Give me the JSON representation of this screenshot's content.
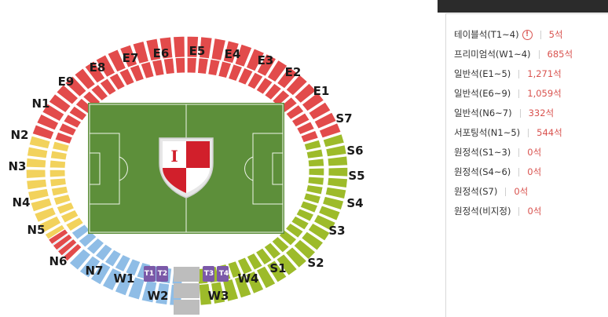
{
  "stadium": {
    "colors": {
      "east": "#e24b4b",
      "north": "#f2d25c",
      "south": "#9dbb2a",
      "west": "#8fbde6",
      "table": "#7b59a8",
      "pitch": "#5d8f3a",
      "gray": "#bdbdbd"
    },
    "sections": {
      "E1": "E1",
      "E2": "E2",
      "E3": "E3",
      "E4": "E4",
      "E5": "E5",
      "E6": "E6",
      "E7": "E7",
      "E8": "E8",
      "E9": "E9",
      "N1": "N1",
      "N2": "N2",
      "N3": "N3",
      "N4": "N4",
      "N5": "N5",
      "N6": "N6",
      "N7": "N7",
      "S1": "S1",
      "S2": "S2",
      "S3": "S3",
      "S4": "S4",
      "S5": "S5",
      "S6": "S6",
      "S7": "S7",
      "W1": "W1",
      "W2": "W2",
      "W3": "W3",
      "W4": "W4",
      "T1": "T1",
      "T2": "T2",
      "T3": "T3",
      "T4": "T4"
    },
    "logo_letter": "I"
  },
  "panel": {
    "rows": [
      {
        "name": "테이블석(T1~4)",
        "count": "5석",
        "info_icon": "!"
      },
      {
        "name": "프리미엄석(W1~4)",
        "count": "685석"
      },
      {
        "name": "일반석(E1~5)",
        "count": "1,271석"
      },
      {
        "name": "일반석(E6~9)",
        "count": "1,059석"
      },
      {
        "name": "일반석(N6~7)",
        "count": "332석"
      },
      {
        "name": "서포팅석(N1~5)",
        "count": "544석"
      },
      {
        "name": "원정석(S1~3)",
        "count": "0석"
      },
      {
        "name": "원정석(S4~6)",
        "count": "0석"
      },
      {
        "name": "원정석(S7)",
        "count": "0석"
      },
      {
        "name": "원정석(비지정)",
        "count": "0석"
      }
    ]
  }
}
